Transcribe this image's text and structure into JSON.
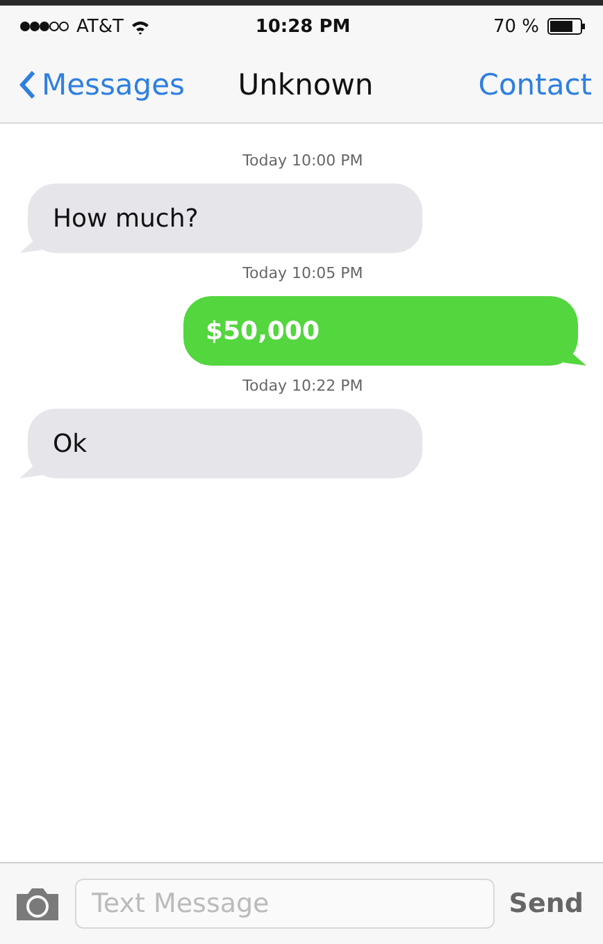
{
  "status_bar": {
    "carrier": "AT&T",
    "time": "10:28 PM",
    "battery": "70 %"
  },
  "nav": {
    "back": "Messages",
    "title": "Unknown",
    "action": "Contact"
  },
  "messages": [
    {
      "timestamp": "Today 10:00 PM",
      "kind": "incoming",
      "text": "How much?"
    },
    {
      "timestamp": "Today 10:05 PM",
      "kind": "outgoing",
      "text": "$50,000"
    },
    {
      "timestamp": "Today 10:22 PM",
      "kind": "incoming",
      "text": "Ok"
    }
  ],
  "composer": {
    "placeholder": "Text Message",
    "send": "Send"
  }
}
